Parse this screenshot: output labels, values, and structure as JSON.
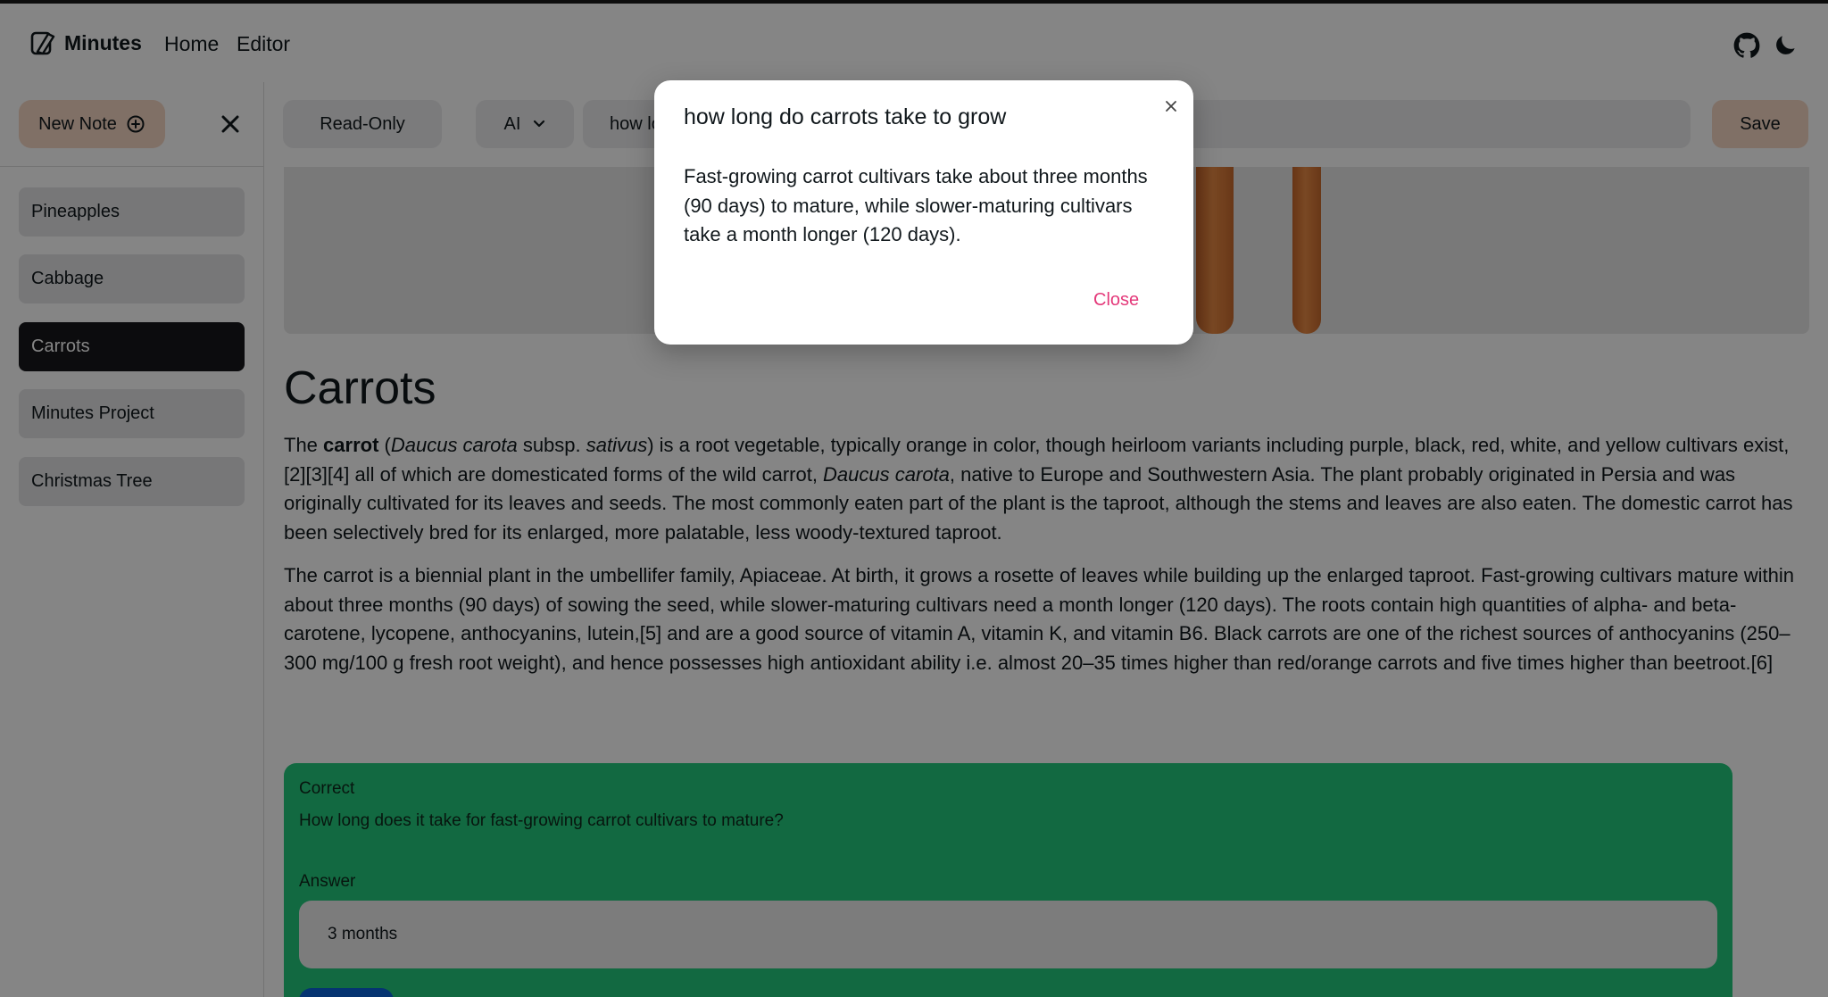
{
  "app": {
    "name": "Minutes"
  },
  "nav": {
    "home": "Home",
    "editor": "Editor"
  },
  "icons": {
    "brand": "notebook-logo-icon",
    "github": "github-icon",
    "theme": "moon-icon",
    "new_note": "plus-circle-icon",
    "close": "close-icon",
    "chevron": "chevron-down-icon"
  },
  "sidebar": {
    "new_note_label": "New Note",
    "notes": [
      {
        "label": "Pineapples",
        "active": false
      },
      {
        "label": "Cabbage",
        "active": false
      },
      {
        "label": "Carrots",
        "active": true
      },
      {
        "label": "Minutes Project",
        "active": false
      },
      {
        "label": "Christmas Tree",
        "active": false
      }
    ]
  },
  "toolbar": {
    "readonly_label": "Read-Only",
    "ai_label": "AI",
    "ai_input_value": "how long do carrots take to grow",
    "save_label": "Save"
  },
  "note": {
    "title": "Carrots",
    "p1": {
      "a": "The ",
      "b": "carrot",
      "c": " (",
      "d": "Daucus carota",
      "e": " subsp. ",
      "f": "sativus",
      "g": ") is a root vegetable, typically orange in color, though heirloom variants including purple, black, red, white, and yellow cultivars exist,[2][3][4] all of which are domesticated forms of the wild carrot, ",
      "h": "Daucus carota",
      "i": ", native to Europe and Southwestern Asia. The plant probably originated in Persia and was originally cultivated for its leaves and seeds. The most commonly eaten part of the plant is the taproot, although the stems and leaves are also eaten. The domestic carrot has been selectively bred for its enlarged, more palatable, less woody-textured taproot."
    },
    "p2": "The carrot is a biennial plant in the umbellifer family, Apiaceae. At birth, it grows a rosette of leaves while building up the enlarged taproot. Fast-growing cultivars mature within about three months (90 days) of sowing the seed, while slower-maturing cultivars need a month longer (120 days). The roots contain high quantities of alpha- and beta-carotene, lycopene, anthocyanins, lutein,[5] and are a good source of vitamin A, vitamin K, and vitamin B6. Black carrots are one of the richest sources of anthocyanins (250–300 mg/100 g fresh root weight), and hence possesses high antioxidant ability i.e. almost 20–35 times higher than red/orange carrots and five times higher than beetroot.[6]"
  },
  "quiz": {
    "status": "Correct",
    "question": "How long does it take for fast-growing carrot cultivars to mature?",
    "answer_label": "Answer",
    "answer_value": "3 months",
    "color": "#24c97e"
  },
  "modal": {
    "title": "how long do carrots take to grow",
    "body": "Fast-growing carrot cultivars take about three months (90 days) to mature, while slower-maturing cultivars take a month longer (120 days).",
    "close_label": "Close"
  },
  "colors": {
    "accent": "#f6d6c3",
    "link": "#e4397a",
    "active": "#18181b",
    "submit": "#0a64d8"
  }
}
